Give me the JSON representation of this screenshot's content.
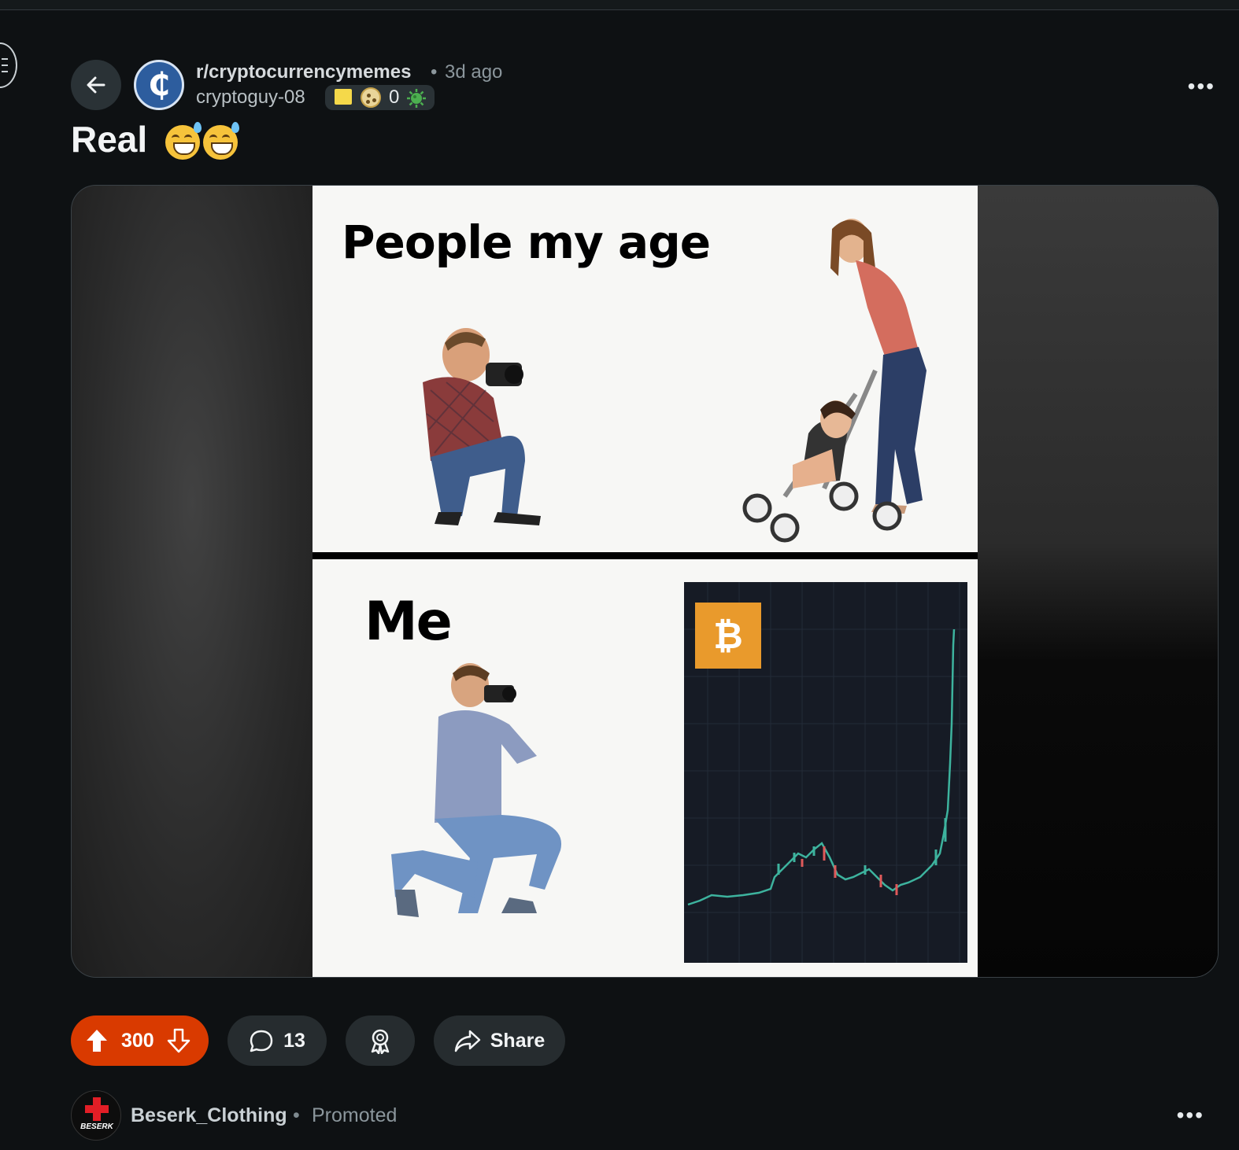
{
  "post": {
    "subreddit": "r/cryptocurrencymemes",
    "separator": "•",
    "time_ago": "3d ago",
    "username": "cryptoguy-08",
    "flair_count": "0",
    "title": "Real",
    "title_emojis": [
      "grinning-face-with-sweat-emoji",
      "grinning-face-with-sweat-emoji"
    ],
    "more_label": "•••"
  },
  "meme": {
    "top_caption": "People my age",
    "bottom_caption": "Me",
    "btc_symbol": "₿"
  },
  "actions": {
    "score": "300",
    "comments": "13",
    "share_label": "Share"
  },
  "promoted": {
    "brand_logo_text": "BESERK",
    "name": "Beserk_Clothing",
    "separator": "•",
    "label": "Promoted",
    "more_label": "•••"
  },
  "colors": {
    "background": "#0e1113",
    "upvote_pill": "#d93a00",
    "pill": "#262c2f",
    "bitcoin_orange": "#e99a2c",
    "subreddit_avatar": "#2d5d9e"
  },
  "icons": [
    "menu-icon",
    "back-arrow-icon",
    "subreddit-coin-icon",
    "upvote-icon",
    "downvote-icon",
    "comment-icon",
    "award-icon",
    "share-icon",
    "more-icon"
  ]
}
